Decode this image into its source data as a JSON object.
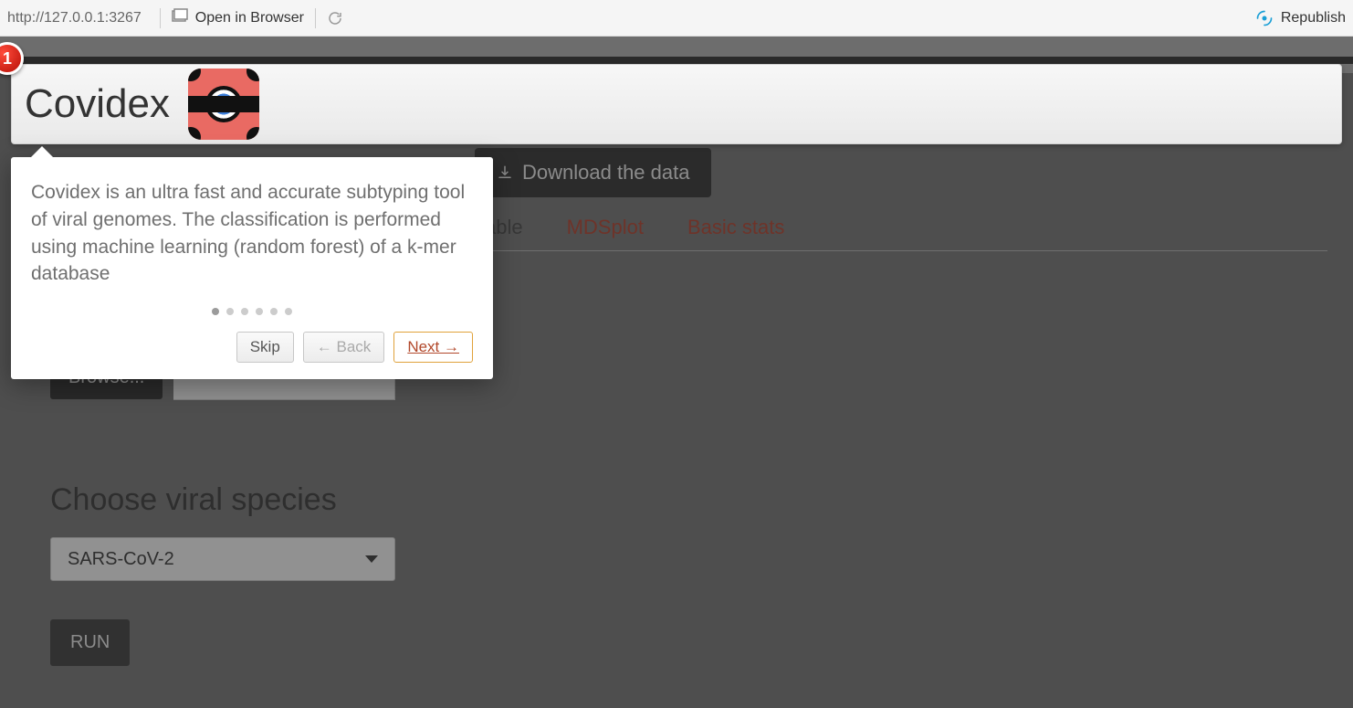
{
  "topbar": {
    "url": "http://127.0.0.1:3267",
    "open_in_browser": "Open in Browser",
    "republish": "Republish"
  },
  "header": {
    "title": "Covidex"
  },
  "tour": {
    "step_badge": "1",
    "text": "Covidex is an ultra fast and accurate subtyping tool of viral genomes. The classification is performed using machine learning (random forest) of a k-mer database",
    "total_dots": 6,
    "active_dot": 0,
    "skip": "Skip",
    "back": "← Back",
    "next": "Next →"
  },
  "download_label": "Download the data",
  "tabs": {
    "items": [
      "Table",
      "MDSplot",
      "Basic stats"
    ],
    "active_index": 0
  },
  "left": {
    "browse": "Browse...",
    "section_title": "Choose viral species",
    "selected_species": "SARS-CoV-2",
    "run": "RUN"
  }
}
